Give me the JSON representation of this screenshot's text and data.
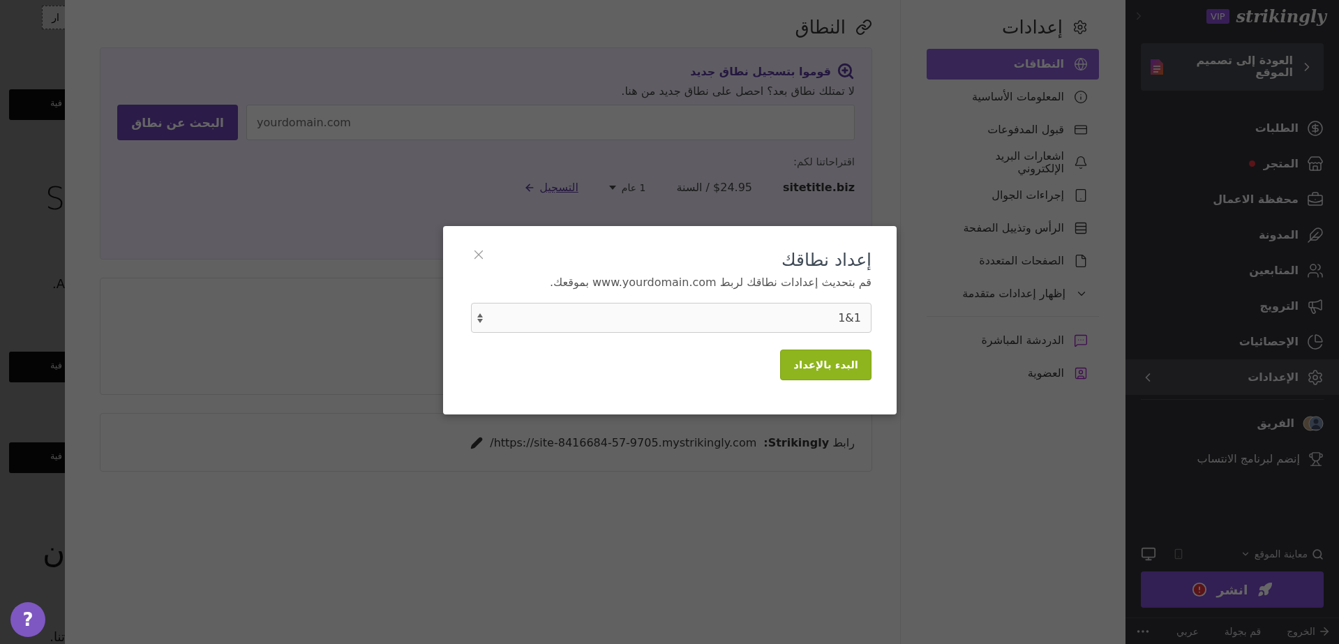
{
  "background_site": {
    "fragments": [
      {
        "kind": "outlined",
        "text": "ار"
      },
      {
        "kind": "button",
        "text": "فية"
      },
      {
        "kind": "heading",
        "text": "S"
      },
      {
        "kind": "text",
        "text": "A."
      },
      {
        "kind": "button",
        "text": "فية"
      },
      {
        "kind": "button",
        "text": "فية"
      },
      {
        "kind": "heading",
        "text": "ن"
      },
      {
        "kind": "text",
        "text": "تنا."
      }
    ]
  },
  "settings_menu": {
    "title": "إعدادات",
    "items": [
      {
        "kind": "link",
        "label": "النطاقات",
        "selected": true
      },
      {
        "kind": "link",
        "label": "المعلومات الأساسية",
        "selected": false
      },
      {
        "kind": "link",
        "label": "قبول المدفوعات",
        "selected": false
      },
      {
        "kind": "link",
        "label": "اشعارات البريد الإلكتروني",
        "selected": false
      },
      {
        "kind": "link",
        "label": "إجراءات الجوال",
        "selected": false
      },
      {
        "kind": "link",
        "label": "الرأس وتذييل الصفحة",
        "selected": false
      },
      {
        "kind": "link",
        "label": "الصفحات المتعددة",
        "selected": false
      },
      {
        "kind": "toggle",
        "label": "إظهار إعدادات متقدمة",
        "expanded": false
      }
    ],
    "extra_items": [
      {
        "label": "الدردشة المباشرة",
        "selected": false
      },
      {
        "label": "العضوية",
        "selected": false
      }
    ]
  },
  "domain": {
    "title": "النطاق",
    "register": {
      "title": "قوموا بتسجيل نطاق جديد",
      "description": "لا تمتلك نطاق بعد؟ احصل على نطاق جديد من هنا.",
      "search_placeholder": "yourdomain.com",
      "search_button": "البحث عن نطاق",
      "suggestions_label": "اقتراحاتنا لكم:",
      "suggestions": [
        {
          "name": "sitetitle.biz",
          "price": "$24.95 / السنة",
          "term": "1 عام",
          "action": "التسجيل"
        }
      ]
    },
    "site_link": {
      "label": "رابط **Strikingly:**",
      "url": "https://site-8416684-57-9705.mystrikingly.com/"
    }
  },
  "modal": {
    "title": "إعداد نطاقك",
    "description": "قم بتحديث إعدادات نطاقك لربط www.yourdomain.com بموقعك.",
    "provider": "1&1",
    "button": "البدء بالإعداد"
  },
  "sidebar": {
    "logo": "strikingly",
    "badge": "VIP",
    "back": "العودة إلى تصميم الموقع",
    "items": [
      {
        "label": "الطلبات",
        "selected": false,
        "notification": false
      },
      {
        "label": "المتجر",
        "selected": false,
        "notification": true
      },
      {
        "label": "محفظة الاعمال",
        "selected": false,
        "notification": false
      },
      {
        "label": "المدونة",
        "selected": false,
        "notification": false
      },
      {
        "label": "المتابعين",
        "selected": false,
        "notification": false
      },
      {
        "label": "الترويج",
        "selected": false,
        "notification": false
      },
      {
        "label": "الإحصائيات",
        "selected": false,
        "notification": false
      },
      {
        "label": "الإعدادات",
        "selected": true,
        "notification": false
      }
    ],
    "extra_items": [
      {
        "label": "الفريق"
      },
      {
        "label": "إنضم لبرنامج الانتساب"
      }
    ],
    "preview": "معاينة الموقع",
    "publish": "انشر",
    "footer": [
      "الخروج",
      "قم بجولة",
      "عربي"
    ]
  },
  "help_button": "?"
}
